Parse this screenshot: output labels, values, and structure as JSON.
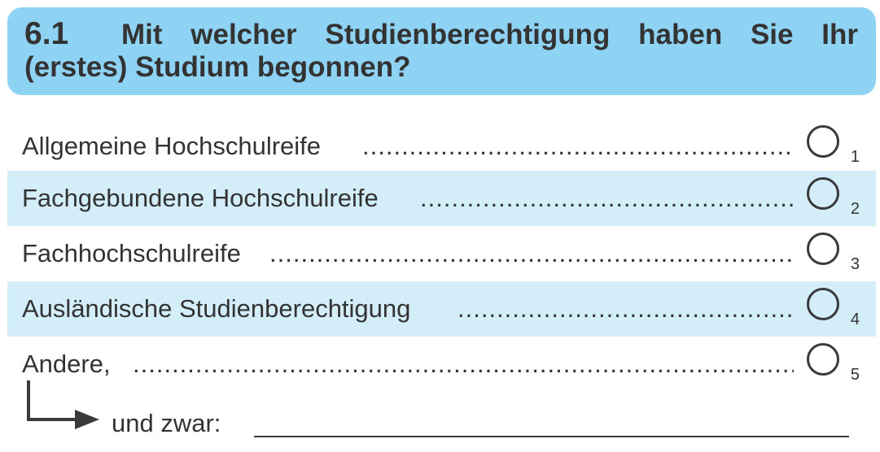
{
  "question": {
    "number": "6.1",
    "line1": "Mit welcher Studienberechtigung haben Sie Ihr",
    "line2": "(erstes) Studium begonnen?",
    "line1_words": [
      "Mit",
      "welcher",
      "Studienberechtigung",
      "haben",
      "Sie",
      "Ihr"
    ]
  },
  "options": [
    {
      "label": "Allgemeine Hochschulreife",
      "code": "1",
      "selected": false
    },
    {
      "label": "Fachgebundene Hochschulreife",
      "code": "2",
      "selected": false
    },
    {
      "label": "Fachhochschulreife",
      "code": "3",
      "selected": false
    },
    {
      "label": "Ausländische Studienberechtigung",
      "code": "4",
      "selected": false
    },
    {
      "label": "Andere,",
      "code": "5",
      "selected": false
    }
  ],
  "other": {
    "label": "und zwar:",
    "value": ""
  },
  "colors": {
    "header_bg": "#8fd3f4",
    "row_shade": "#d3edf9",
    "text": "#333333"
  },
  "icons": {
    "radio": "radio-circle-icon",
    "arrow": "corner-arrow-right-icon"
  }
}
